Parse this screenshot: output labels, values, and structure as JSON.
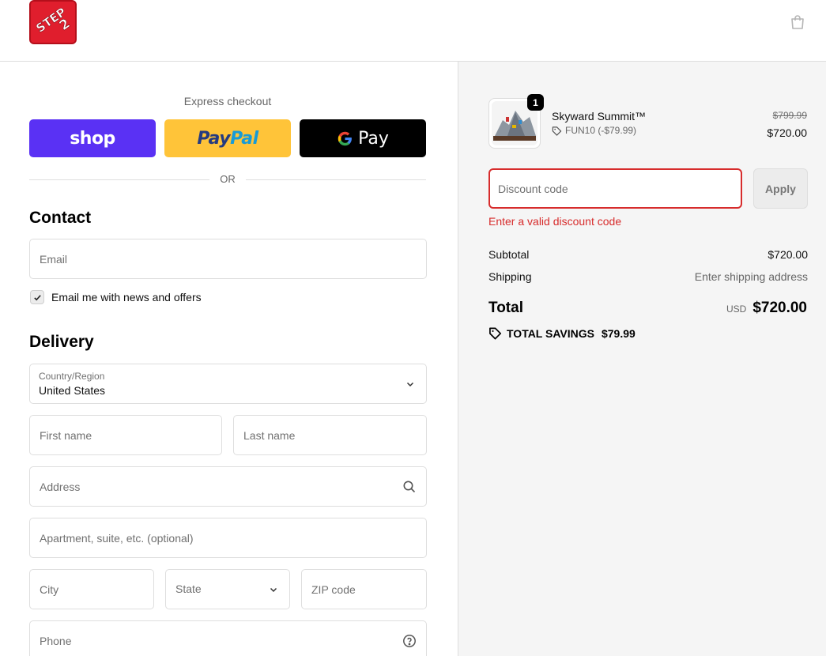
{
  "header": {
    "logo_icon": "step2-logo",
    "cart_icon": "shopping-bag-icon"
  },
  "express": {
    "label": "Express checkout",
    "shop_label": "shop",
    "paypal_label_1": "Pay",
    "paypal_label_2": "Pal",
    "gpay_label": "Pay",
    "or_label": "OR"
  },
  "contact": {
    "title": "Contact",
    "email_placeholder": "Email",
    "newsletter_label": "Email me with news and offers",
    "newsletter_checked": true
  },
  "delivery": {
    "title": "Delivery",
    "country_label": "Country/Region",
    "country_value": "United States",
    "first_name_placeholder": "First name",
    "last_name_placeholder": "Last name",
    "address_placeholder": "Address",
    "apartment_placeholder": "Apartment, suite, etc. (optional)",
    "city_placeholder": "City",
    "state_placeholder": "State",
    "zip_placeholder": "ZIP code",
    "phone_placeholder": "Phone"
  },
  "order": {
    "product": {
      "quantity": "1",
      "name": "Skyward Summit™",
      "discount": "FUN10 (-$79.99)",
      "original_price": "$799.99",
      "price": "$720.00"
    },
    "discount_placeholder": "Discount code",
    "apply_label": "Apply",
    "discount_error": "Enter a valid discount code",
    "subtotal_label": "Subtotal",
    "subtotal_value": "$720.00",
    "shipping_label": "Shipping",
    "shipping_value": "Enter shipping address",
    "total_label": "Total",
    "total_currency": "USD",
    "total_value": "$720.00",
    "savings_label": "TOTAL SAVINGS",
    "savings_value": "$79.99"
  },
  "colors": {
    "shop_purple": "#5a31f4",
    "paypal_yellow": "#ffc439",
    "error_red": "#d72c2c"
  }
}
